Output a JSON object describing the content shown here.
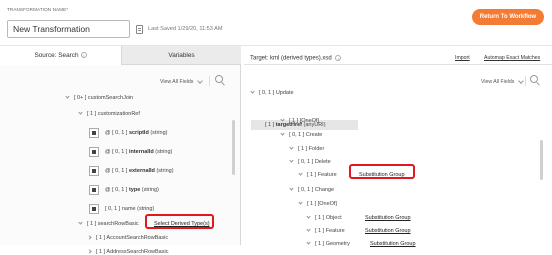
{
  "header": {
    "transformation_name_label": "TRANSFORMATION NAME*",
    "transformation_name_value": "New Transformation",
    "last_saved": "Last Saved 1/29/20, 11:53 AM",
    "return_button": "Return To Workflow"
  },
  "left": {
    "tabs": [
      {
        "label": "Source: Search"
      },
      {
        "label": "Variables"
      }
    ],
    "view_all": "View All Fields",
    "tree": [
      {
        "text": "[ 0+ ] customSearchJoin"
      },
      {
        "text": "[ 1 ] customizationRef"
      },
      {
        "prefix": "@ [ 0, 1 ] ",
        "bold": "scriptId",
        "suffix": " (string)"
      },
      {
        "prefix": "@ [ 0, 1 ] ",
        "bold": "internalId",
        "suffix": " (string)"
      },
      {
        "prefix": "@ [ 0, 1 ] ",
        "bold": "externalId",
        "suffix": " (string)"
      },
      {
        "prefix": "@ [ 0, 1 ] ",
        "bold": "type",
        "suffix": " (string)"
      },
      {
        "prefix": "[ 0, 1 ] ",
        "bold": "",
        "suffix": "name (string)"
      },
      {
        "text": "[ 1 ] searchRowBasic"
      },
      {
        "text": "[ 1 ] AccountSearchRowBasic"
      },
      {
        "text": "[ 1 ] AddressSearchRowBasic"
      }
    ],
    "select_link": "Select Derived Type(s)"
  },
  "right": {
    "target": "Target: kml (derived types).xsd",
    "import": "Import",
    "automap": "Automap Exact Matches",
    "view_all": "View All Fields",
    "tree": [
      {
        "text": "[ 0, 1 ] Update"
      },
      {
        "prefix": "[ 1 ] ",
        "bold": "targetHref",
        "suffix": " (anyURI)"
      },
      {
        "text": "[ 1 ] [OneOf]"
      },
      {
        "text": "[ 0, 1 ] Create"
      },
      {
        "text": "[ 1 ] Folder"
      },
      {
        "text": "[ 0, 1 ] Delete"
      },
      {
        "text": "[ 1 ] Feature"
      },
      {
        "text": "[ 0, 1 ] Change"
      },
      {
        "text": "[ 1 ] [OneOf]"
      },
      {
        "text": "[ 1 ] Object"
      },
      {
        "text": "[ 1 ] Feature"
      },
      {
        "text": "[ 1 ] Geometry"
      }
    ],
    "sub_group": "Substitution Group"
  }
}
